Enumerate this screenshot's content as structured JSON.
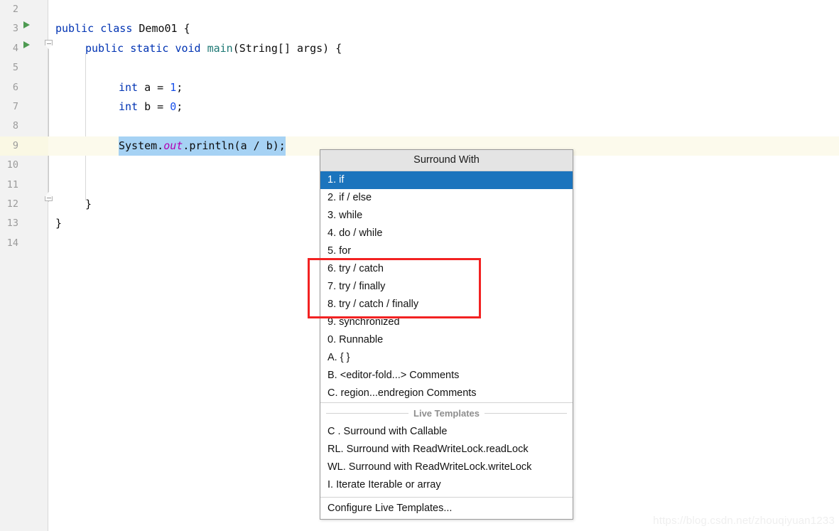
{
  "editor": {
    "gutter": {
      "line_numbers": [
        "2",
        "3",
        "4",
        "5",
        "6",
        "7",
        "8",
        "9",
        "10",
        "11",
        "12",
        "13",
        "14"
      ]
    },
    "caret_line": "9",
    "lines": [
      {
        "num": "2",
        "indent": 0,
        "tokens": []
      },
      {
        "num": "3",
        "indent": 78,
        "tokens": [
          {
            "t": "public ",
            "c": "kw"
          },
          {
            "t": "class ",
            "c": "kw"
          },
          {
            "t": "Demo01 {",
            "c": "plain"
          }
        ]
      },
      {
        "num": "4",
        "indent": 120,
        "tokens": [
          {
            "t": "public ",
            "c": "kw"
          },
          {
            "t": "static ",
            "c": "kw"
          },
          {
            "t": "void ",
            "c": "kw"
          },
          {
            "t": "main",
            "c": "mth"
          },
          {
            "t": "(String[] args) {",
            "c": "plain"
          }
        ]
      },
      {
        "num": "5",
        "indent": 0,
        "tokens": []
      },
      {
        "num": "6",
        "indent": 167,
        "tokens": [
          {
            "t": "int ",
            "c": "kw"
          },
          {
            "t": "a = ",
            "c": "plain"
          },
          {
            "t": "1",
            "c": "num"
          },
          {
            "t": ";",
            "c": "plain"
          }
        ]
      },
      {
        "num": "7",
        "indent": 167,
        "tokens": [
          {
            "t": "int ",
            "c": "kw"
          },
          {
            "t": "b = ",
            "c": "plain"
          },
          {
            "t": "0",
            "c": "num"
          },
          {
            "t": ";",
            "c": "plain"
          }
        ]
      },
      {
        "num": "8",
        "indent": 0,
        "tokens": []
      },
      {
        "num": "9",
        "indent": 167,
        "tokens": [
          {
            "t": "System.",
            "c": "plain"
          },
          {
            "t": "out",
            "c": "fld"
          },
          {
            "t": ".println(a / b);",
            "c": "plain"
          }
        ]
      },
      {
        "num": "10",
        "indent": 0,
        "tokens": []
      },
      {
        "num": "11",
        "indent": 0,
        "tokens": []
      },
      {
        "num": "12",
        "indent": 120,
        "tokens": [
          {
            "t": "}",
            "c": "plain"
          }
        ]
      },
      {
        "num": "13",
        "indent": 78,
        "tokens": [
          {
            "t": "}",
            "c": "plain"
          }
        ]
      },
      {
        "num": "14",
        "indent": 0,
        "tokens": []
      }
    ]
  },
  "popup": {
    "title": "Surround With",
    "items": [
      {
        "label": "1. if",
        "selected": true
      },
      {
        "label": "2. if / else",
        "selected": false
      },
      {
        "label": "3. while",
        "selected": false
      },
      {
        "label": "4. do / while",
        "selected": false
      },
      {
        "label": "5. for",
        "selected": false
      },
      {
        "label": "6. try / catch",
        "selected": false
      },
      {
        "label": "7. try / finally",
        "selected": false
      },
      {
        "label": "8. try / catch / finally",
        "selected": false
      },
      {
        "label": "9. synchronized",
        "selected": false
      },
      {
        "label": "0. Runnable",
        "selected": false
      },
      {
        "label": "A. { }",
        "selected": false
      },
      {
        "label": "B. <editor-fold...> Comments",
        "selected": false
      },
      {
        "label": "C. region...endregion Comments",
        "selected": false
      }
    ],
    "section_label": "Live Templates",
    "template_items": [
      {
        "label": "C . Surround with Callable"
      },
      {
        "label": "RL. Surround with ReadWriteLock.readLock"
      },
      {
        "label": "WL. Surround with ReadWriteLock.writeLock"
      },
      {
        "label": "I. Iterate Iterable or array"
      }
    ],
    "footer": "Configure Live Templates..."
  },
  "annotation": {
    "kind": "red-rectangle-highlight",
    "color": "#f22222",
    "highlights": [
      "6. try / catch",
      "7. try / finally",
      "8. try / catch / finally"
    ]
  },
  "watermark": {
    "text": "https://blog.csdn.net/zhouqiyuan1233"
  },
  "colors": {
    "selected_row": "#1b74bd",
    "header_bg": "#e4e4e4",
    "caret_row": "#fcfaec",
    "selection": "#a6d2f4",
    "keyword": "#0033b3",
    "annotation": "#f22222"
  }
}
